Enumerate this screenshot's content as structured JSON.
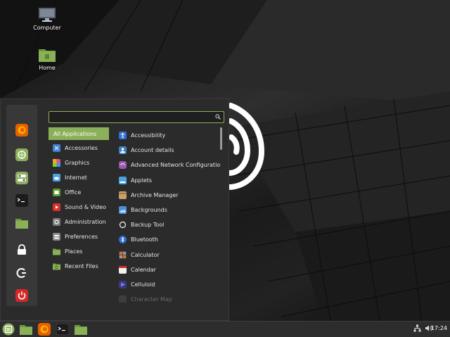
{
  "desktop": {
    "icons": [
      {
        "label": "Computer"
      },
      {
        "label": "Home"
      }
    ]
  },
  "menu": {
    "search": {
      "value": "",
      "placeholder": ""
    },
    "categories": [
      {
        "label": "All Applications",
        "icon": "grid-icon",
        "selected": true
      },
      {
        "label": "Accessories",
        "icon": "scissors-icon"
      },
      {
        "label": "Graphics",
        "icon": "palette-icon"
      },
      {
        "label": "Internet",
        "icon": "cloud-icon"
      },
      {
        "label": "Office",
        "icon": "spreadsheet-icon"
      },
      {
        "label": "Sound & Video",
        "icon": "play-icon"
      },
      {
        "label": "Administration",
        "icon": "gear-icon"
      },
      {
        "label": "Preferences",
        "icon": "settings-icon"
      },
      {
        "label": "Places",
        "icon": "folder-icon"
      },
      {
        "label": "Recent Files",
        "icon": "recent-folder-icon"
      }
    ],
    "applications": [
      {
        "label": "Accessibility",
        "color": "#2f6fd1"
      },
      {
        "label": "Account details",
        "color": "#3f7fbf"
      },
      {
        "label": "Advanced Network Configuration",
        "color": "#9b59b6"
      },
      {
        "label": "Applets",
        "color": "#4aa3df"
      },
      {
        "label": "Archive Manager",
        "color": "#c8a068"
      },
      {
        "label": "Backgrounds",
        "color": "#4a90d9"
      },
      {
        "label": "Backup Tool",
        "color": "#555555"
      },
      {
        "label": "Bluetooth",
        "color": "#2f6fd1"
      },
      {
        "label": "Calculator",
        "color": "#e07020"
      },
      {
        "label": "Calendar",
        "color": "#f0f0f0"
      },
      {
        "label": "Celluloid",
        "color": "#5a5ad0"
      },
      {
        "label": "Character Map",
        "color": "#555555"
      }
    ],
    "favorites": [
      {
        "name": "firefox"
      },
      {
        "name": "software-manager"
      },
      {
        "name": "settings"
      },
      {
        "name": "terminal"
      },
      {
        "name": "files"
      },
      {
        "name": "lock"
      },
      {
        "name": "logout"
      },
      {
        "name": "power"
      }
    ]
  },
  "panel": {
    "clock": "17:24"
  },
  "colors": {
    "accent": "#8ab05a",
    "panel": "#2d2d2d",
    "menu_bg": "#2b2b2b",
    "power_red": "#d62828",
    "firefox_orange": "#e66000"
  }
}
